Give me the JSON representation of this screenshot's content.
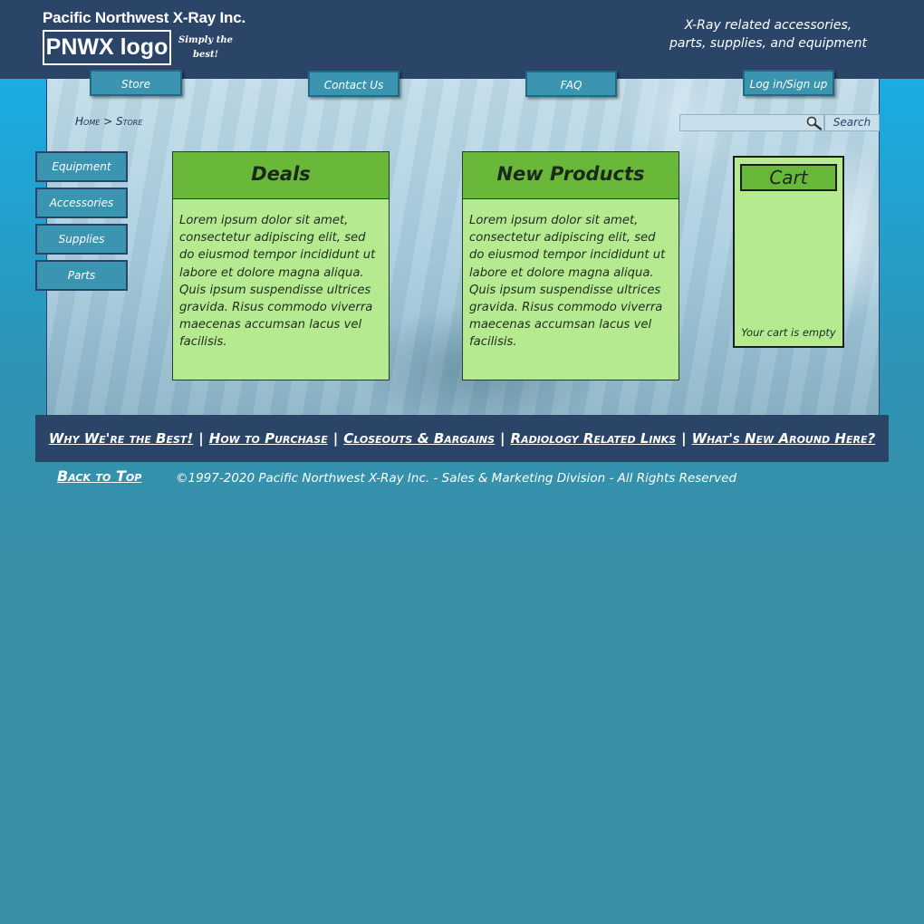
{
  "header": {
    "company_name": "Pacific Northwest X-Ray Inc.",
    "logo_text": "PNWX logo",
    "tagline": "Simply the best!",
    "description_line1": "X-Ray related accessories,",
    "description_line2": "parts, supplies, and equipment"
  },
  "nav": {
    "store": "Store",
    "contact": "Contact Us",
    "faq": "FAQ",
    "login": "Log in/Sign up"
  },
  "breadcrumb": {
    "home": "Home",
    "separator": ">",
    "current": "Store"
  },
  "search": {
    "value": "",
    "button": "Search",
    "icon": "search-icon"
  },
  "sidebar": {
    "items": [
      {
        "label": "Equipment"
      },
      {
        "label": "Accessories"
      },
      {
        "label": "Supplies"
      },
      {
        "label": "Parts"
      }
    ]
  },
  "deals": {
    "title": "Deals",
    "body": "Lorem ipsum dolor sit amet, consectetur adipiscing elit, sed do eiusmod tempor incididunt ut labore et dolore magna aliqua. Quis ipsum suspendisse ultrices gravida. Risus commodo viverra maecenas accumsan lacus vel facilisis."
  },
  "new_products": {
    "title": "New Products",
    "body": "Lorem ipsum dolor sit amet, consectetur adipiscing elit, sed do eiusmod tempor incididunt ut labore et dolore magna aliqua. Quis ipsum suspendisse ultrices gravida. Risus commodo viverra maecenas accumsan lacus vel facilisis."
  },
  "cart": {
    "title": "Cart",
    "empty_message": "Your cart is empty"
  },
  "footer": {
    "links": [
      {
        "label": "Why We're the Best!"
      },
      {
        "label": "How to Purchase"
      },
      {
        "label": "Closeouts & Bargains"
      },
      {
        "label": "Radiology Related Links"
      },
      {
        "label": "What's New Around Here?"
      }
    ],
    "separator": "|",
    "back_to_top": "Back to Top",
    "copyright": "©1997-2020 Pacific Northwest X-Ray Inc. - Sales & Marketing Division - All Rights Reserved"
  },
  "colors": {
    "header_bg": "#2b4568",
    "button_bg": "#3b94b0",
    "card_header": "#6ab83a",
    "card_body": "#b6ea90",
    "page_bg": "#3a8fa6"
  }
}
